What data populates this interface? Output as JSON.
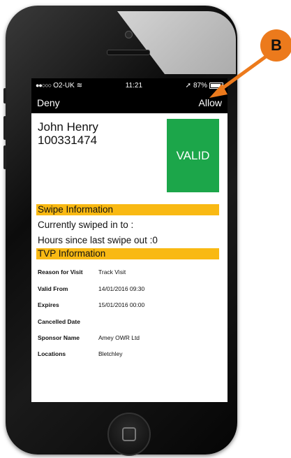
{
  "status_bar": {
    "carrier": "O2-UK",
    "time": "11:21",
    "battery": "87%",
    "battery_level": 0.87
  },
  "nav": {
    "deny": "Deny",
    "allow": "Allow"
  },
  "person": {
    "name": "John Henry",
    "id": "100331474",
    "status": "VALID"
  },
  "swipe": {
    "header": "Swipe Information",
    "currently": "Currently swiped in to :",
    "hours": "Hours since last swipe out :0"
  },
  "tvp": {
    "header": "TVP Information",
    "rows": [
      {
        "label": "Reason for Visit",
        "value": "Track Visit"
      },
      {
        "label": "Valid From",
        "value": "14/01/2016 09:30"
      },
      {
        "label": "Expires",
        "value": "15/01/2016 00:00"
      },
      {
        "label": "Cancelled Date",
        "value": ""
      },
      {
        "label": "Sponsor Name",
        "value": "Amey OWR Ltd"
      },
      {
        "label": "Locations",
        "value": "Bletchley"
      }
    ]
  },
  "annotation": {
    "label": "B"
  },
  "colors": {
    "valid": "#1ca64a",
    "section": "#f9b913",
    "marker": "#ec7a1c"
  }
}
